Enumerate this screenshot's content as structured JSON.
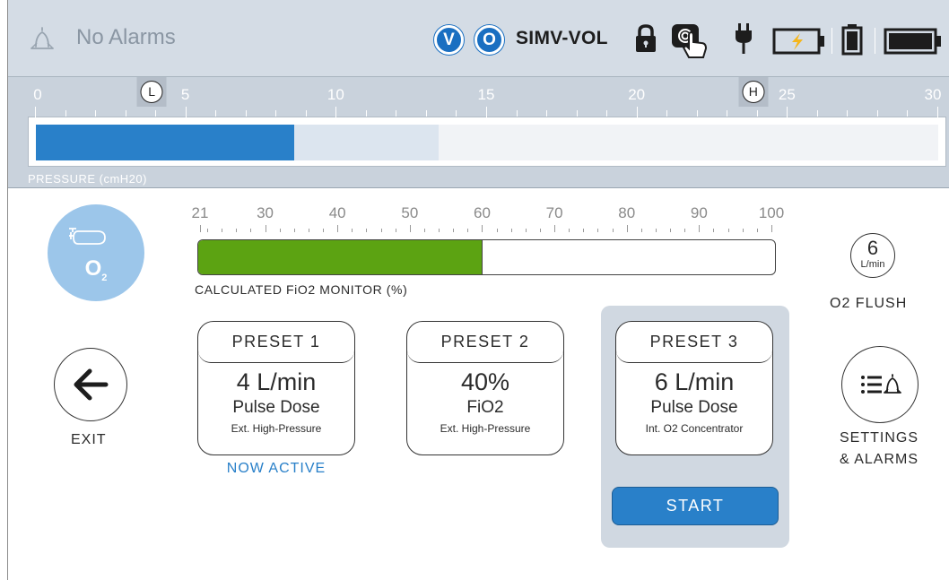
{
  "header": {
    "alarm_status": "No Alarms",
    "badge_v": "V",
    "badge_o": "O",
    "mode": "SIMV-VOL",
    "icons": [
      "bell-icon",
      "lock-icon",
      "touch-icon",
      "plug-icon",
      "battery-charging-icon",
      "battery-small-icon",
      "battery-full-icon"
    ]
  },
  "pressure": {
    "label": "PRESSURE (cmH20)",
    "ticks": [
      "0",
      "5",
      "10",
      "15",
      "20",
      "25",
      "30"
    ],
    "low_marker": "L",
    "high_marker": "H",
    "range": [
      0,
      30
    ],
    "low_value": 4,
    "high_value": 24,
    "current_value": 8.6,
    "peak_value": 13.4,
    "colors": {
      "fill": "#2980c9",
      "peak": "#dce5ef"
    }
  },
  "fio2": {
    "caption": "CALCULATED FiO2 MONITOR (%)",
    "ticks": [
      "21",
      "30",
      "40",
      "50",
      "60",
      "70",
      "80",
      "90",
      "100"
    ],
    "range": [
      21,
      100
    ],
    "value": 60,
    "color": "#5ca312"
  },
  "o2": {
    "label_main": "O",
    "label_sub": "2",
    "icon": "oxygen-cylinder-icon"
  },
  "flush": {
    "value": "6",
    "unit": "L/min",
    "label": "O2 FLUSH"
  },
  "exit": {
    "label": "EXIT",
    "icon": "arrow-left-icon"
  },
  "settings": {
    "line1": "SETTINGS",
    "line2": "& ALARMS",
    "icon": "list-bell-icon"
  },
  "presets": [
    {
      "title": "PRESET 1",
      "value": "4 L/min",
      "type": "Pulse Dose",
      "source": "Ext. High-Pressure"
    },
    {
      "title": "PRESET 2",
      "value": "40%",
      "type": "FiO2",
      "source": "Ext. High-Pressure"
    },
    {
      "title": "PRESET 3",
      "value": "6 L/min",
      "type": "Pulse Dose",
      "source": "Int. O2 Concentrator"
    }
  ],
  "now_active": "NOW ACTIVE",
  "start_label": "START"
}
